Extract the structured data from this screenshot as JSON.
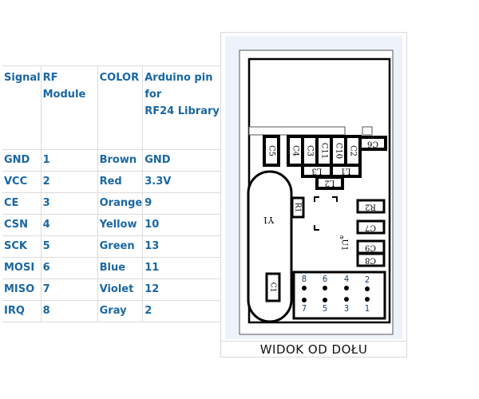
{
  "table": {
    "headers": {
      "signal": "Signal",
      "rf_module": "RF Module",
      "color": "COLOR",
      "arduino_pin_line1": "Arduino pin",
      "arduino_pin_line2": "for",
      "arduino_pin_line3": "RF24 Library"
    },
    "rows": [
      {
        "signal": "GND",
        "rf_module": "1",
        "color": "Brown",
        "arduino": "GND"
      },
      {
        "signal": "VCC",
        "rf_module": "2",
        "color": "Red",
        "arduino": "3.3V"
      },
      {
        "signal": "CE",
        "rf_module": "3",
        "color": "Orange",
        "arduino": "9"
      },
      {
        "signal": "CSN",
        "rf_module": "4",
        "color": "Yellow",
        "arduino": "10"
      },
      {
        "signal": "SCK",
        "rf_module": "5",
        "color": "Green",
        "arduino": "13"
      },
      {
        "signal": "MOSI",
        "rf_module": "6",
        "color": "Blue",
        "arduino": "11"
      },
      {
        "signal": "MISO",
        "rf_module": "7",
        "color": "Violet",
        "arduino": "12"
      },
      {
        "signal": "IRQ",
        "rf_module": "8",
        "color": "Gray",
        "arduino": "2"
      }
    ]
  },
  "figure": {
    "caption": "WIDOK OD DOŁU",
    "components": {
      "C5": "C5",
      "C4": "C4",
      "C3": "C3",
      "C11": "C11",
      "C10": "C10",
      "C2": "C2",
      "C6": "C6",
      "L3": "L3",
      "L1": "L1",
      "L2": "L2",
      "R1": "R1",
      "R2": "R2",
      "C7": "C7",
      "C9": "C9",
      "C8": "C8",
      "C1": "C1",
      "Y1": "Y1",
      "U1": "U1"
    },
    "header_pins_top": [
      "8",
      "6",
      "4",
      "2"
    ],
    "header_pins_bottom": [
      "7",
      "5",
      "3",
      "1"
    ],
    "colors": {
      "text": "#1a67a3",
      "pin_label": "#1a3d6e"
    }
  }
}
